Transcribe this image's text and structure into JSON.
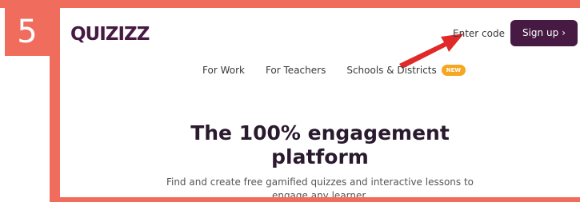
{
  "annotation": {
    "step_number": "5",
    "frame_color": "#f06d5e"
  },
  "header": {
    "logo_text": "QUIZIZZ",
    "enter_code": "Enter code",
    "signup_label": "Sign up",
    "signup_chevron": "›",
    "brand_color": "#461a42"
  },
  "nav": {
    "items": [
      {
        "label": "For Work"
      },
      {
        "label": "For Teachers"
      },
      {
        "label": "Schools & Districts",
        "badge": "NEW"
      }
    ],
    "badge_color": "#f5a623"
  },
  "hero": {
    "headline": "The 100% engagement platform",
    "subtext": "Find and create free gamified quizzes and interactive lessons to engage any learner."
  }
}
